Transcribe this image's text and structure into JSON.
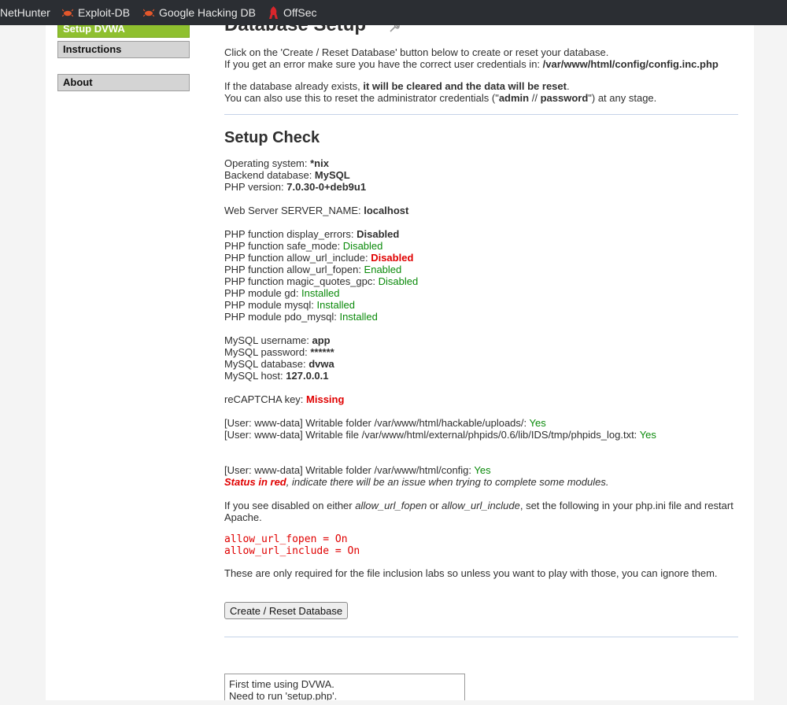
{
  "bookmarks": [
    {
      "label": "NetHunter",
      "icon": "nethunter-icon"
    },
    {
      "label": "Exploit-DB",
      "icon": "exploit-db-icon"
    },
    {
      "label": "Google Hacking DB",
      "icon": "ghdb-icon"
    },
    {
      "label": "OffSec",
      "icon": "offsec-icon"
    }
  ],
  "sidebar": {
    "items": [
      {
        "label": "Setup DVWA",
        "selected": true
      },
      {
        "label": "Instructions"
      },
      {
        "label": "About"
      }
    ]
  },
  "main": {
    "title": "Database Setup",
    "intro": {
      "l1": "Click on the 'Create / Reset Database' button below to create or reset your database.",
      "l2_prefix": "If you get an error make sure you have the correct user credentials in: ",
      "l2_path": "/var/www/html/config/config.inc.php",
      "l3_prefix": "If the database already exists, ",
      "l3_bold": "it will be cleared and the data will be reset",
      "l3_suffix": ".",
      "l4_prefix": "You can also use this to reset the administrator credentials (\"",
      "l4_admin": "admin",
      "l4_mid": " // ",
      "l4_password": "password",
      "l4_suffix": "\") at any stage."
    },
    "setup_check": {
      "heading": "Setup Check",
      "os_label": "Operating system: ",
      "os_value": "*nix",
      "db_label": "Backend database: ",
      "db_value": "MySQL",
      "php_label": "PHP version: ",
      "php_value": "7.0.30-0+deb9u1",
      "server_label": "Web Server SERVER_NAME: ",
      "server_value": "localhost",
      "functions": [
        {
          "label": "PHP function display_errors: ",
          "value": "Disabled",
          "status": "bold"
        },
        {
          "label": "PHP function safe_mode: ",
          "value": "Disabled",
          "status": "green"
        },
        {
          "label": "PHP function allow_url_include: ",
          "value": "Disabled",
          "status": "redbold"
        },
        {
          "label": "PHP function allow_url_fopen: ",
          "value": "Enabled",
          "status": "green"
        },
        {
          "label": "PHP function magic_quotes_gpc: ",
          "value": "Disabled",
          "status": "green"
        },
        {
          "label": "PHP module gd: ",
          "value": "Installed",
          "status": "green"
        },
        {
          "label": "PHP module mysql: ",
          "value": "Installed",
          "status": "green"
        },
        {
          "label": "PHP module pdo_mysql: ",
          "value": "Installed",
          "status": "green"
        }
      ],
      "mysql": [
        {
          "label": "MySQL username: ",
          "value": "app"
        },
        {
          "label": "MySQL password: ",
          "value": "******"
        },
        {
          "label": "MySQL database: ",
          "value": "dvwa"
        },
        {
          "label": "MySQL host: ",
          "value": "127.0.0.1"
        }
      ],
      "recaptcha_label": "reCAPTCHA key: ",
      "recaptcha_value": "Missing",
      "writable": [
        {
          "label": "[User: www-data] Writable folder /var/www/html/hackable/uploads/: ",
          "value": "Yes"
        },
        {
          "label": "[User: www-data] Writable file /var/www/html/external/phpids/0.6/lib/IDS/tmp/phpids_log.txt: ",
          "value": "Yes"
        },
        {
          "label": "[User: www-data] Writable folder /var/www/html/config: ",
          "value": "Yes"
        }
      ],
      "status_note_red": "Status in red",
      "status_note_rest": ", indicate there will be an issue when trying to complete some modules.",
      "disabled_note_1": "If you see disabled on either ",
      "disabled_note_fopen": "allow_url_fopen",
      "disabled_note_or": " or ",
      "disabled_note_include": "allow_url_include",
      "disabled_note_2": ", set the following in your php.ini file and restart",
      "disabled_note_3": "Apache.",
      "ini_line_1": "allow_url_fopen = On",
      "ini_line_2": "allow_url_include = On",
      "labs_note": "These are only required for the file inclusion labs so unless you want to play with those, you can ignore them."
    },
    "create_button": "Create / Reset Database",
    "info_box": {
      "line1": "First time using DVWA.",
      "line2": "Need to run 'setup.php'."
    }
  },
  "colors": {
    "menu_selected": "#8fc02f",
    "status_green": "#0a8a0a",
    "status_red": "#e00000",
    "bookmarks_bar": "#2b2e33"
  }
}
